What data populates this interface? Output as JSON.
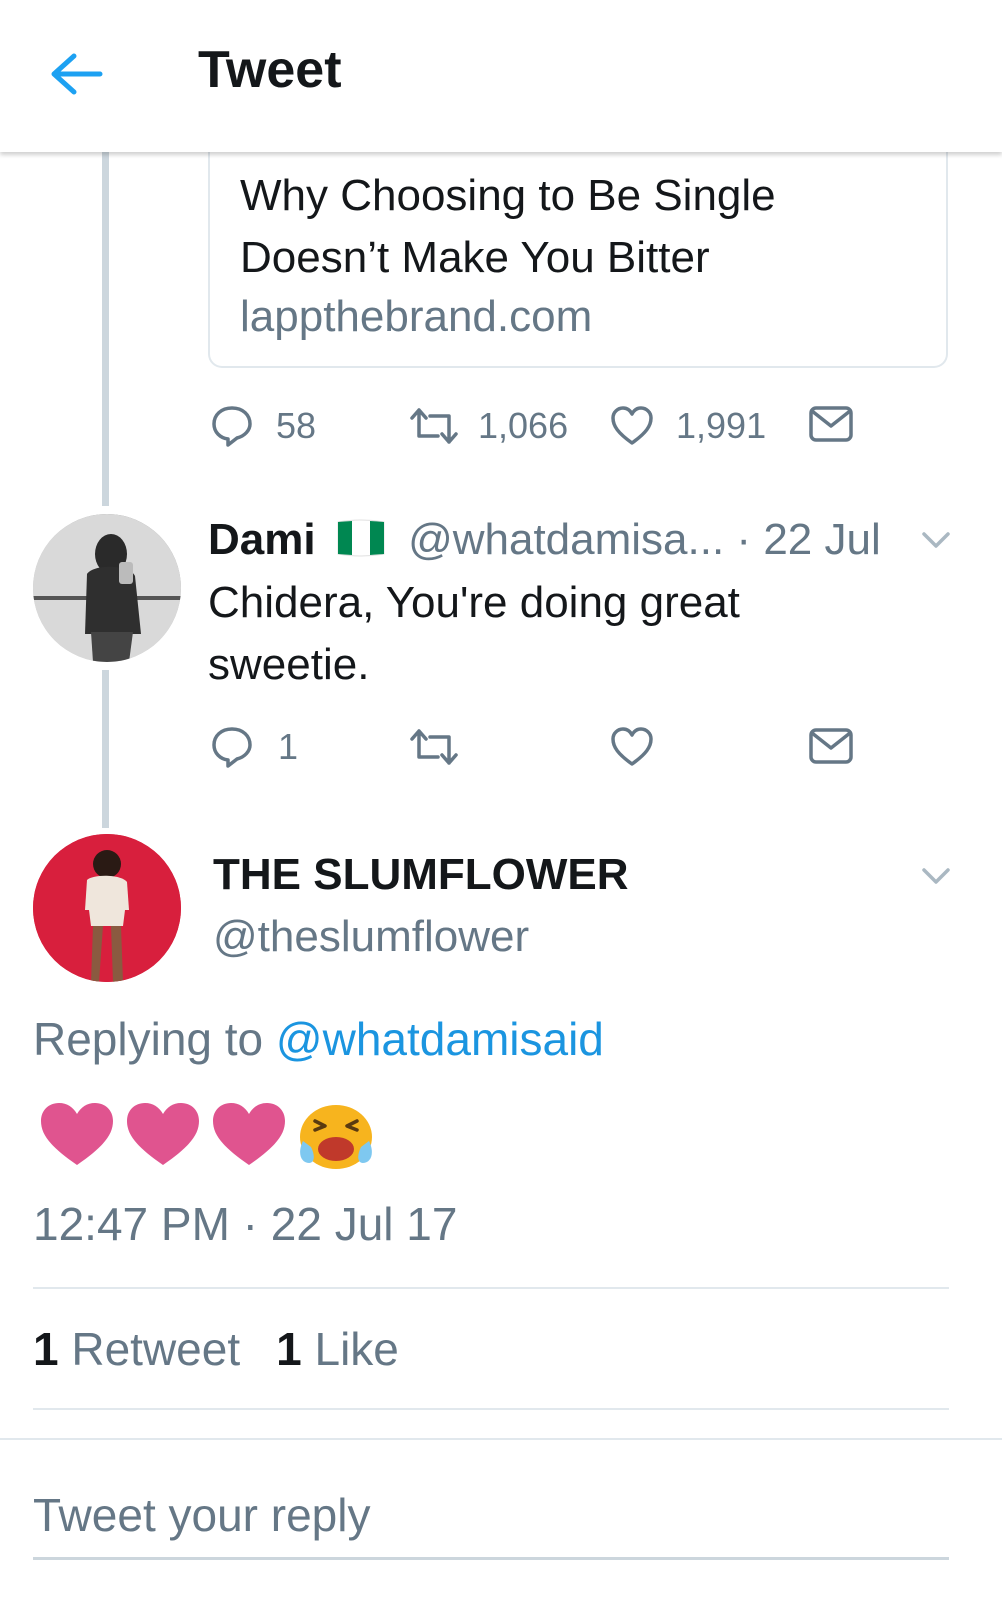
{
  "header": {
    "title": "Tweet",
    "back_icon": "arrow-left-icon",
    "accent": "#1da1f2"
  },
  "link_card": {
    "title": "Why Choosing to Be Single Doesn’t Make You Bitter",
    "domain": "lappthebrand.com"
  },
  "parent_actions": {
    "replies": "58",
    "retweets": "1,066",
    "likes": "1,991"
  },
  "reply_tweet": {
    "name": "Dami",
    "flag": "nigeria-flag-icon",
    "handle": "@whatdamisa...",
    "separator": "·",
    "time": "22 Jul",
    "text": "Chidera,  You're doing great sweetie.",
    "replies": "1"
  },
  "main_tweet": {
    "name": "THE SLUMFLOWER",
    "handle": "@theslumflower",
    "replying_prefix": "Replying to",
    "replying_to": "@whatdamisaid",
    "emojis": [
      "heart-icon",
      "heart-icon",
      "heart-icon",
      "crying-face-icon"
    ],
    "timestamp": "12:47 PM · 22 Jul 17",
    "retweet_count": "1",
    "retweet_label": "Retweet",
    "like_count": "1",
    "like_label": "Like"
  },
  "reply_box": {
    "placeholder": "Tweet your reply"
  },
  "colors": {
    "muted": "#657786",
    "link": "#1b95e0",
    "heart": "#e0548f",
    "emoji_yellow": "#f7b41e"
  }
}
